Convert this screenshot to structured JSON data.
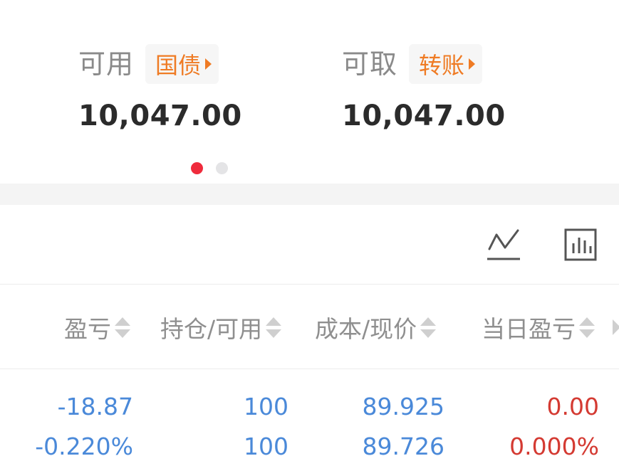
{
  "balance": {
    "available": {
      "label": "可用",
      "tag": "国债",
      "amount": "10,047.00"
    },
    "withdrawable": {
      "label": "可取",
      "tag": "转账",
      "amount": "10,047.00"
    }
  },
  "pager": {
    "total": 2,
    "active": 0
  },
  "toolbar": {
    "icons": [
      "trend-line-icon",
      "bar-chart-icon"
    ]
  },
  "table": {
    "columns": [
      "盈亏",
      "持仓/可用",
      "成本/现价",
      "当日盈亏"
    ],
    "rows": [
      {
        "pnl": "-18.87",
        "pnl_pct": "-0.220%",
        "position": "100",
        "available": "100",
        "cost": "89.925",
        "price": "89.726",
        "day_pnl": "0.00",
        "day_pnl_pct": "0.000%"
      }
    ]
  },
  "colors": {
    "accent_orange": "#ef7b24",
    "loss_blue": "#4a89d9",
    "gain_red": "#d43a32",
    "active_dot": "#ef2b3c"
  }
}
